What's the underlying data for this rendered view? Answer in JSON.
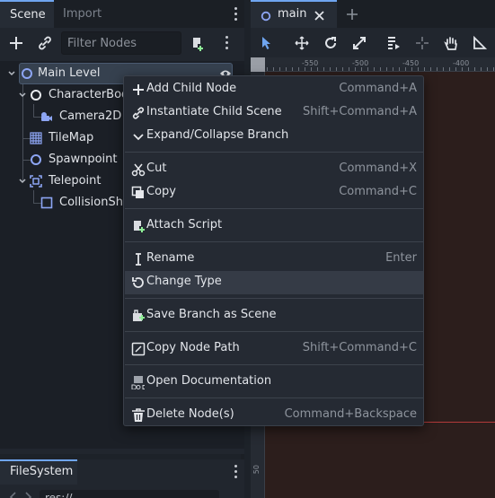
{
  "scene_dock": {
    "tabs": [
      {
        "label": "Scene",
        "active": true
      },
      {
        "label": "Import",
        "active": false
      }
    ],
    "toolbar": {
      "filter": {
        "value": "",
        "placeholder": "Filter Nodes"
      }
    },
    "tree": [
      {
        "label": "Main Level",
        "icon": "node-circle-icon",
        "depth": 0,
        "expanded": true,
        "selected": true
      },
      {
        "label": "CharacterBody",
        "icon": "character-body-icon",
        "depth": 1,
        "expanded": true
      },
      {
        "label": "Camera2D",
        "icon": "camera-icon",
        "depth": 2
      },
      {
        "label": "TileMap",
        "icon": "tilemap-grid-icon",
        "depth": 1
      },
      {
        "label": "Spawnpoint",
        "icon": "node-circle-icon",
        "depth": 1
      },
      {
        "label": "Telepoint",
        "icon": "area-icon",
        "depth": 1,
        "expanded": true
      },
      {
        "label": "CollisionSha",
        "icon": "collision-shape-icon",
        "depth": 2
      }
    ]
  },
  "editor": {
    "tabs": [
      {
        "label": "main",
        "closable": true
      }
    ],
    "ruler_labels": [
      "-550",
      "-500",
      "-450",
      "-400"
    ],
    "ruler_v_label": "50"
  },
  "filesystem": {
    "tab_label": "FileSystem",
    "path": "res://"
  },
  "context_menu": {
    "items": [
      {
        "label": "Add Child Node",
        "shortcut": "Command+A",
        "icon": "plus-icon"
      },
      {
        "label": "Instantiate Child Scene",
        "shortcut": "Shift+Command+A",
        "icon": "link-icon"
      },
      {
        "label": "Expand/Collapse Branch",
        "shortcut": "",
        "icon": "chevron-down-icon"
      },
      {
        "label": "Cut",
        "shortcut": "Command+X",
        "icon": "scissors-icon"
      },
      {
        "label": "Copy",
        "shortcut": "Command+C",
        "icon": "copy-icon"
      },
      {
        "label": "Attach Script",
        "shortcut": "",
        "icon": "script-add-icon"
      },
      {
        "label": "Rename",
        "shortcut": "Enter",
        "icon": "text-cursor-icon"
      },
      {
        "label": "Change Type",
        "shortcut": "",
        "icon": "rotate-icon",
        "hovered": true
      },
      {
        "label": "Save Branch as Scene",
        "shortcut": "",
        "icon": "save-branch-icon"
      },
      {
        "label": "Copy Node Path",
        "shortcut": "Shift+Command+C",
        "icon": "node-path-icon"
      },
      {
        "label": "Open Documentation",
        "shortcut": "",
        "icon": "doc-icon"
      },
      {
        "label": "Delete Node(s)",
        "shortcut": "Command+Backspace",
        "icon": "trash-icon"
      }
    ]
  },
  "colors": {
    "accent": "#6fa5f0",
    "panel_bg": "#21262e",
    "menu_bg": "#252a33",
    "viewport_bg": "#2c1e1c",
    "node_icon_green": "#8eef97",
    "node_icon_blue": "#8da5f3"
  }
}
